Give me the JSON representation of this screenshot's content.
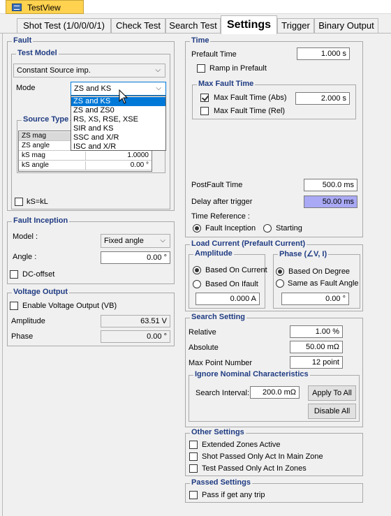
{
  "window": {
    "doc_tab": "TestView"
  },
  "tabs": [
    {
      "label": "Shot Test (1/0/0/0/1)"
    },
    {
      "label": "Check Test"
    },
    {
      "label": "Search Test"
    },
    {
      "label": "Settings"
    },
    {
      "label": "Trigger"
    },
    {
      "label": "Binary Output"
    }
  ],
  "fault": {
    "title": "Fault",
    "test_model": {
      "title": "Test Model",
      "model_value": "Constant Source imp.",
      "mode_label": "Mode",
      "mode_value": "ZS and KS"
    },
    "mode_options": [
      "ZS and KS",
      "ZS and ZS0",
      "RS, XS, RSE, XSE",
      "SIR and KS",
      "SSC and X/R",
      "ISC and X/R"
    ],
    "source_type": {
      "title": "Source Type",
      "rows": [
        {
          "name": "ZS mag",
          "value": ""
        },
        {
          "name": "ZS angle",
          "value": ""
        },
        {
          "name": "kS mag",
          "value": "1.0000"
        },
        {
          "name": "kS angle",
          "value": "0.00 °"
        }
      ]
    },
    "ks_kl_label": "kS=kL"
  },
  "fault_inception": {
    "title": "Fault Inception",
    "model_label": "Model :",
    "model_value": "Fixed angle",
    "angle_label": "Angle :",
    "angle_value": "0.00 °",
    "dc_offset_label": "DC-offset"
  },
  "voltage_output": {
    "title": "Voltage Output",
    "enable_label": "Enable Voltage Output (VB)",
    "amplitude_label": "Amplitude",
    "amplitude_value": "63.51 V",
    "phase_label": "Phase",
    "phase_value": "0.00 °"
  },
  "time": {
    "title": "Time",
    "prefault_label": "Prefault Time",
    "prefault_value": "1.000 s",
    "ramp_label": "Ramp in Prefault",
    "max_fault_time": {
      "title": "Max Fault Time",
      "abs_label": "Max Fault Time (Abs)",
      "abs_value": "2.000 s",
      "rel_label": "Max Fault Time (Rel)"
    },
    "postfault_label": "PostFault Time",
    "postfault_value": "500.0 ms",
    "delay_label": "Delay after trigger",
    "delay_value": "50.00 ms",
    "time_ref_label": "Time Reference :",
    "ref_fault_label": "Fault Inception",
    "ref_start_label": "Starting"
  },
  "load_current": {
    "title": "Load Current (Prefault Current)",
    "amplitude": {
      "title": "Amplitude",
      "opt1": "Based On Current",
      "opt2": "Based On Ifault",
      "value": "0.000 A"
    },
    "phase": {
      "title": "Phase (∠V, I)",
      "opt1": "Based On Degree",
      "opt2": "Same as Fault Angle",
      "value": "0.00 °"
    }
  },
  "search_setting": {
    "title": "Search Setting",
    "relative_label": "Relative",
    "relative_value": "1.00 %",
    "absolute_label": "Absolute",
    "absolute_value": "50.00 mΩ",
    "max_point_label": "Max Point Number",
    "max_point_value": "12 point",
    "ignore": {
      "title": "Ignore Nominal Characteristics",
      "interval_label": "Search Interval:",
      "interval_value": "200.0 mΩ",
      "apply_label": "Apply To All",
      "disable_label": "Disable All"
    }
  },
  "other_settings": {
    "title": "Other Settings",
    "opt1": "Extended Zones Active",
    "opt2": "Shot Passed Only Act In Main Zone",
    "opt3": "Test Passed Only Act In Zones"
  },
  "passed_settings": {
    "title": "Passed Settings",
    "opt1": "Pass if get any trip"
  }
}
